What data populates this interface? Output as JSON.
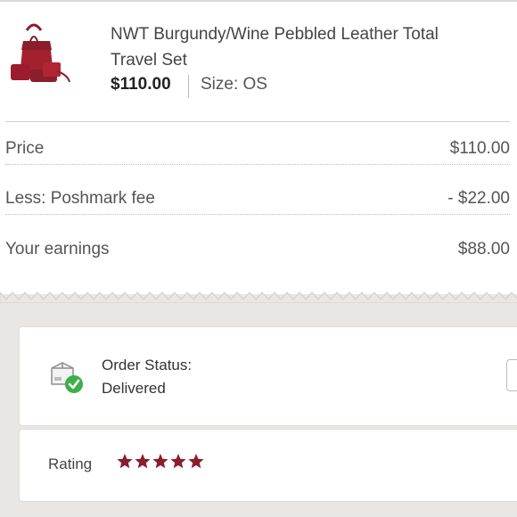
{
  "listing": {
    "title": "NWT Burgundy/Wine Pebbled Leather Total Travel Set",
    "price": "$110.00",
    "size": "Size: OS",
    "thumbnail_icon": "handbag-set-image"
  },
  "breakdown": {
    "rows": [
      {
        "label": "Price",
        "value": "$110.00"
      },
      {
        "label": "Less: Poshmark fee",
        "value": "- $22.00"
      },
      {
        "label": "Your earnings",
        "value": "$88.00"
      }
    ]
  },
  "order_status": {
    "label": "Order Status:",
    "value": "Delivered",
    "icon": "package-delivered-icon"
  },
  "rating": {
    "label": "Rating",
    "stars": 5,
    "max_stars": 5,
    "star_color": "#8b1e2b"
  },
  "colors": {
    "accent": "#8b1e2b",
    "success": "#3fae49",
    "background": "#e9e6e3"
  }
}
